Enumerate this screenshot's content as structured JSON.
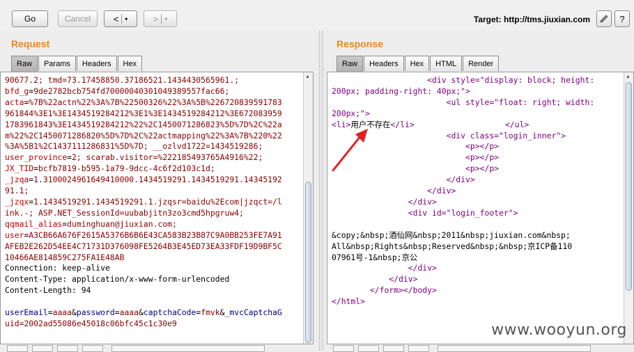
{
  "toolbar": {
    "go_label": "Go",
    "cancel_label": "Cancel",
    "back_arrow": "<",
    "forward_arrow": ">",
    "dropdown_glyph": "▾",
    "target_label": "Target: http://tms.jiuxian.com",
    "edit_icon": "pencil-icon",
    "help_icon": "help-icon",
    "help_glyph": "?"
  },
  "request": {
    "title": "Request",
    "tabs": [
      "Raw",
      "Params",
      "Headers",
      "Hex"
    ],
    "active_tab": "Raw",
    "lines": {
      "l1": "90677.2; tmd=73.17458850.37186521.1434430565961.;",
      "l2n": "bfd_g",
      "l2v": "9de2782bcb754fd70000040301049389557fac66;",
      "l3n": "acta",
      "l3v": "%7B%22actn%22%3A%7B%22500326%22%3A%5B%226720839591783",
      "l4": "961844%3E1%3E1434519284212%3E1%3E1434519284212%3E672083959",
      "l5": "1783961843%3E1434519284212%22%2C1450071286823%5D%7D%2C%22a",
      "l6": "m%22%2C1450071286820%5D%7D%2C%22actmapping%22%3A%7B%220%22",
      "l7": "%3A%5B1%2C1437111286831%5D%7D; __ozlvd1722=1434519286;",
      "l8n": "user_province",
      "l8v": "2; scarab.visitor=%222185493765A4916%22;",
      "l9n": "JX_TID",
      "l9v": "bcfb7819-b595-1a79-9dcc-4c6f2d103c1d;",
      "l10n": "_jzqa",
      "l10v": "1.3100024961649410000.1434519291.1434519291.14345192",
      "l11": "91.1;",
      "l12n": "_jzqx",
      "l12v": "1.1434519291.1434519291.1.jzqsr=baidu%2Ecom|jzqct=/l",
      "l13": "ink.-; ASP.NET_SessionId=uubabjitn3zo3cmd5hpgruw4;",
      "l14n": "qqmail_alias",
      "l14v": "duminghuan@jiuxian.com;",
      "l15n": "user",
      "l15v": "A3CB66A676F2615A5376B6B6E43CA583B23B87C9A0BB253FE7A91",
      "l16": "AFEB2E262D54EE4C71731D376098FE5264B3E45ED73EA33FDF19D9BF5C",
      "l17": "10466AE814859C275FA1E48AB",
      "l18": "Connection: keep-alive",
      "l19": "Content-Type: application/x-www-form-urlencoded",
      "l20": "Content-Length: 94",
      "l21a_n": "userEmail",
      "l21a_v": "aaaa",
      "l21b_n": "password",
      "l21b_v": "aaaa",
      "l21c_n": "captchaCode",
      "l21c_v": "fmvk",
      "l21d_n": "_mvcCaptchaG",
      "l22": "uid=2002ad55086e45018c06bfc45c1c30e9"
    }
  },
  "response": {
    "title": "Response",
    "tabs": [
      "Raw",
      "Headers",
      "Hex",
      "HTML",
      "Render"
    ],
    "active_tab": "Raw",
    "lines": {
      "r1": "<div style=\"display: block; height:",
      "r2": "200px; padding-right: 40px;\">",
      "r3": "<ul style=\"float: right; width:",
      "r4": "200px;\">",
      "r5a": "<li>",
      "r5b": "用户不存在",
      "r5c": "</li>",
      "r5d": "</ul>",
      "r6": "<div class=\"login_inner\">",
      "r7": "<p></p>",
      "r8": "<p></p>",
      "r9": "<p></p>",
      "r10": "</div>",
      "r11": "</div>",
      "r12": "</div>",
      "r13": "<div id=\"login_footer\">",
      "r14": "&copy;&nbsp;酒仙网&nbsp;2011&nbsp;jiuxian.com&nbsp;",
      "r15": "All&nbsp;Rights&nbsp;Reserved&nbsp;&nbsp;京ICP备110",
      "r16": "07961号-1&nbsp;京公",
      "r17": "</div>",
      "r18": "</div>",
      "r19": "</form></body>",
      "r20": "</html>"
    }
  },
  "watermark": "www.wooyun.org",
  "colors": {
    "accent": "#e8881f",
    "arrow": "#e02020",
    "tag": "#800080"
  }
}
